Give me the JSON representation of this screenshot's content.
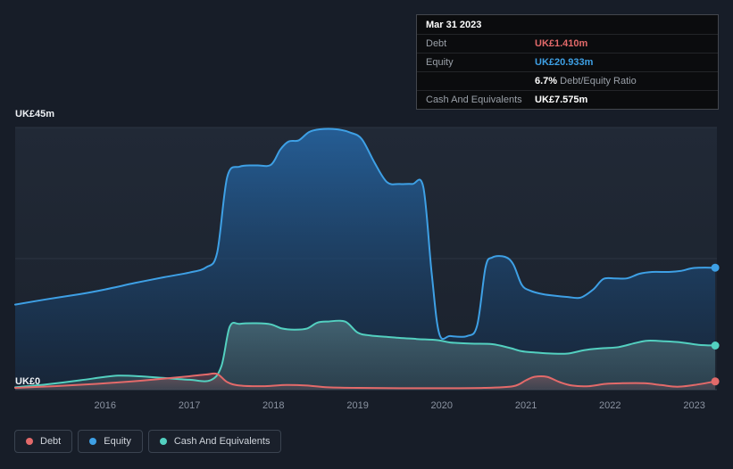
{
  "tooltip": {
    "date": "Mar 31 2023",
    "debt_label": "Debt",
    "debt_value": "UK£1.410m",
    "equity_label": "Equity",
    "equity_value": "UK£20.933m",
    "ratio_value": "6.7%",
    "ratio_label": "Debt/Equity Ratio",
    "cash_label": "Cash And Equivalents",
    "cash_value": "UK£7.575m"
  },
  "legend": [
    {
      "label": "Debt",
      "color": "#e36a6a"
    },
    {
      "label": "Equity",
      "color": "#3ea0e5"
    },
    {
      "label": "Cash And Equivalents",
      "color": "#53d0c0"
    }
  ],
  "chart_data": {
    "type": "area",
    "unit": "UK£ millions",
    "x_range": [
      2014.93,
      2023.27
    ],
    "y_range": [
      0,
      45
    ],
    "y_axis_labels": {
      "top": "UK£45m",
      "bottom": "UK£0"
    },
    "x_ticks": [
      2016,
      2017,
      2018,
      2019,
      2020,
      2021,
      2022,
      2023
    ],
    "gridlines_y": [
      0,
      22.5,
      45
    ],
    "grid": "horizontal-only",
    "legend_position": "bottom-left",
    "series": [
      {
        "name": "Equity",
        "color": "#3ea0e5",
        "fill_top": "rgba(38,106,172,0.80)",
        "fill_bottom": "rgba(20,40,64,0.55)",
        "points": [
          [
            2014.93,
            14.6
          ],
          [
            2015.3,
            15.5
          ],
          [
            2015.7,
            16.4
          ],
          [
            2016.0,
            17.2
          ],
          [
            2016.35,
            18.3
          ],
          [
            2016.7,
            19.3
          ],
          [
            2017.0,
            20.1
          ],
          [
            2017.2,
            21.0
          ],
          [
            2017.33,
            23.5
          ],
          [
            2017.45,
            36.5
          ],
          [
            2017.6,
            38.3
          ],
          [
            2017.8,
            38.5
          ],
          [
            2017.97,
            38.6
          ],
          [
            2018.08,
            41.2
          ],
          [
            2018.18,
            42.6
          ],
          [
            2018.3,
            42.8
          ],
          [
            2018.42,
            44.2
          ],
          [
            2018.55,
            44.7
          ],
          [
            2018.75,
            44.7
          ],
          [
            2018.92,
            44.1
          ],
          [
            2019.05,
            43.0
          ],
          [
            2019.2,
            39.0
          ],
          [
            2019.35,
            35.6
          ],
          [
            2019.5,
            35.3
          ],
          [
            2019.65,
            35.3
          ],
          [
            2019.78,
            34.8
          ],
          [
            2019.88,
            20.0
          ],
          [
            2019.97,
            9.6
          ],
          [
            2020.1,
            9.2
          ],
          [
            2020.3,
            9.2
          ],
          [
            2020.42,
            11.0
          ],
          [
            2020.52,
            21.0
          ],
          [
            2020.6,
            22.7
          ],
          [
            2020.75,
            22.8
          ],
          [
            2020.85,
            21.5
          ],
          [
            2020.95,
            18.0
          ],
          [
            2021.05,
            17.0
          ],
          [
            2021.2,
            16.4
          ],
          [
            2021.35,
            16.1
          ],
          [
            2021.5,
            15.9
          ],
          [
            2021.65,
            15.8
          ],
          [
            2021.8,
            17.2
          ],
          [
            2021.92,
            19.0
          ],
          [
            2022.05,
            19.1
          ],
          [
            2022.2,
            19.1
          ],
          [
            2022.35,
            19.9
          ],
          [
            2022.5,
            20.2
          ],
          [
            2022.7,
            20.2
          ],
          [
            2022.85,
            20.4
          ],
          [
            2023.0,
            20.9
          ],
          [
            2023.25,
            20.933
          ]
        ]
      },
      {
        "name": "Cash And Equivalents",
        "color": "#53d0c0",
        "fill_top": "rgba(125,170,168,0.40)",
        "fill_bottom": "rgba(95,130,130,0.28)",
        "points": [
          [
            2014.93,
            0.4
          ],
          [
            2015.3,
            0.9
          ],
          [
            2015.7,
            1.6
          ],
          [
            2015.95,
            2.1
          ],
          [
            2016.15,
            2.4
          ],
          [
            2016.4,
            2.3
          ],
          [
            2016.7,
            2.0
          ],
          [
            2017.0,
            1.7
          ],
          [
            2017.25,
            1.6
          ],
          [
            2017.38,
            4.0
          ],
          [
            2017.48,
            10.8
          ],
          [
            2017.6,
            11.3
          ],
          [
            2017.8,
            11.4
          ],
          [
            2017.97,
            11.2
          ],
          [
            2018.1,
            10.5
          ],
          [
            2018.25,
            10.3
          ],
          [
            2018.4,
            10.5
          ],
          [
            2018.52,
            11.5
          ],
          [
            2018.65,
            11.7
          ],
          [
            2018.85,
            11.7
          ],
          [
            2019.0,
            9.8
          ],
          [
            2019.15,
            9.3
          ],
          [
            2019.4,
            9.0
          ],
          [
            2019.7,
            8.7
          ],
          [
            2019.95,
            8.5
          ],
          [
            2020.1,
            8.1
          ],
          [
            2020.35,
            7.9
          ],
          [
            2020.6,
            7.8
          ],
          [
            2020.8,
            7.2
          ],
          [
            2020.95,
            6.6
          ],
          [
            2021.1,
            6.4
          ],
          [
            2021.3,
            6.2
          ],
          [
            2021.5,
            6.2
          ],
          [
            2021.7,
            6.8
          ],
          [
            2021.9,
            7.1
          ],
          [
            2022.1,
            7.3
          ],
          [
            2022.3,
            8.0
          ],
          [
            2022.45,
            8.4
          ],
          [
            2022.65,
            8.3
          ],
          [
            2022.85,
            8.1
          ],
          [
            2023.05,
            7.7
          ],
          [
            2023.25,
            7.575
          ]
        ]
      },
      {
        "name": "Debt",
        "color": "#e36a6a",
        "fill_top": "rgba(227,106,106,0.30)",
        "fill_bottom": "rgba(227,106,106,0.10)",
        "points": [
          [
            2014.93,
            0.3
          ],
          [
            2015.4,
            0.6
          ],
          [
            2015.9,
            1.0
          ],
          [
            2016.3,
            1.4
          ],
          [
            2016.7,
            1.9
          ],
          [
            2017.0,
            2.3
          ],
          [
            2017.2,
            2.6
          ],
          [
            2017.33,
            2.7
          ],
          [
            2017.45,
            1.3
          ],
          [
            2017.6,
            0.7
          ],
          [
            2017.9,
            0.6
          ],
          [
            2018.15,
            0.8
          ],
          [
            2018.4,
            0.7
          ],
          [
            2018.65,
            0.4
          ],
          [
            2019.0,
            0.3
          ],
          [
            2019.5,
            0.25
          ],
          [
            2020.0,
            0.25
          ],
          [
            2020.5,
            0.3
          ],
          [
            2020.85,
            0.6
          ],
          [
            2021.0,
            1.6
          ],
          [
            2021.1,
            2.2
          ],
          [
            2021.25,
            2.2
          ],
          [
            2021.4,
            1.3
          ],
          [
            2021.55,
            0.7
          ],
          [
            2021.75,
            0.6
          ],
          [
            2021.95,
            1.0
          ],
          [
            2022.15,
            1.1
          ],
          [
            2022.4,
            1.1
          ],
          [
            2022.6,
            0.8
          ],
          [
            2022.8,
            0.5
          ],
          [
            2023.0,
            0.8
          ],
          [
            2023.25,
            1.41
          ]
        ]
      }
    ]
  }
}
